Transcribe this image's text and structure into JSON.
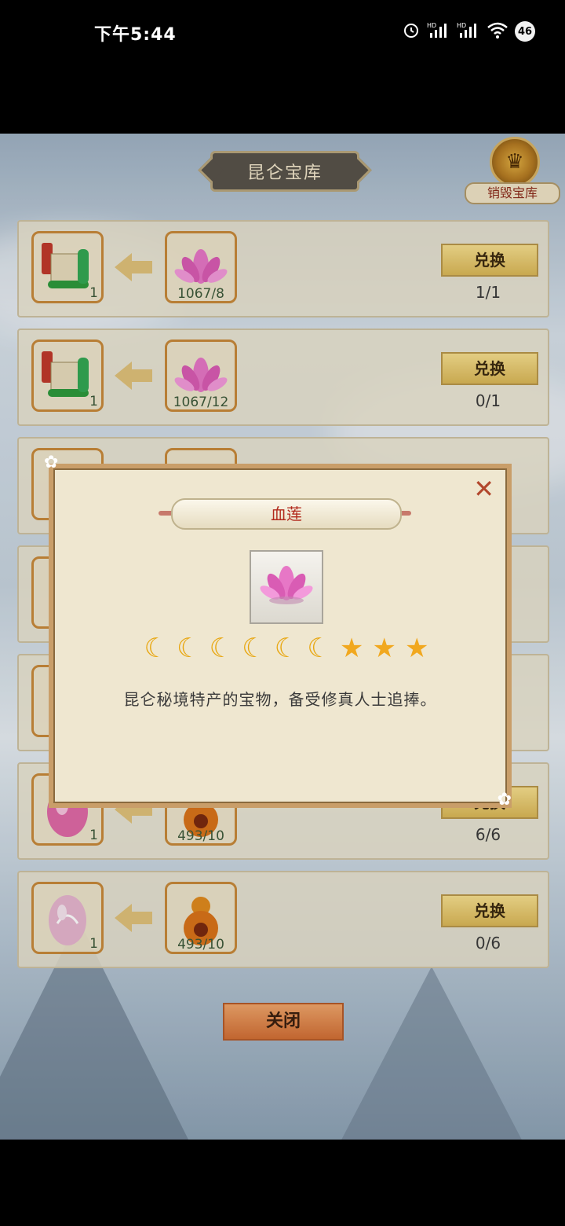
{
  "status_bar": {
    "time": "下午5:44",
    "icons": [
      "alarm-icon",
      "hd-signal-icon",
      "hd-signal-icon",
      "wifi-icon"
    ],
    "badge": "46"
  },
  "header": {
    "title": "昆仑宝库",
    "destroy_label": "销毁宝库"
  },
  "rows": [
    {
      "reward_icon": "scroll-icon",
      "reward_count": "1",
      "cost_icon": "lotus-icon",
      "cost_count": "1067/8",
      "button": "兑换",
      "ratio": "1/1"
    },
    {
      "reward_icon": "scroll-icon",
      "reward_count": "1",
      "cost_icon": "lotus-icon",
      "cost_count": "1067/12",
      "button": "兑换",
      "ratio": "0/1"
    },
    {
      "reward_icon": "egg-icon",
      "reward_count": "1",
      "cost_icon": "gourd-icon",
      "cost_count": "493/10",
      "button": "兑换",
      "ratio": "6/6"
    },
    {
      "reward_icon": "egg-icon",
      "reward_count": "1",
      "cost_icon": "gourd-icon",
      "cost_count": "493/10",
      "button": "兑换",
      "ratio": "0/6"
    }
  ],
  "close_button": "关闭",
  "popup": {
    "item_name": "血莲",
    "item_icon": "lotus-icon",
    "grade": {
      "moons": 6,
      "stars": 3
    },
    "description": "昆仑秘境特产的宝物，备受修真人士追捧。"
  },
  "colors": {
    "accent_red": "#b22a1c",
    "button_gold": "#dab757",
    "slot_border": "#c8893a"
  }
}
